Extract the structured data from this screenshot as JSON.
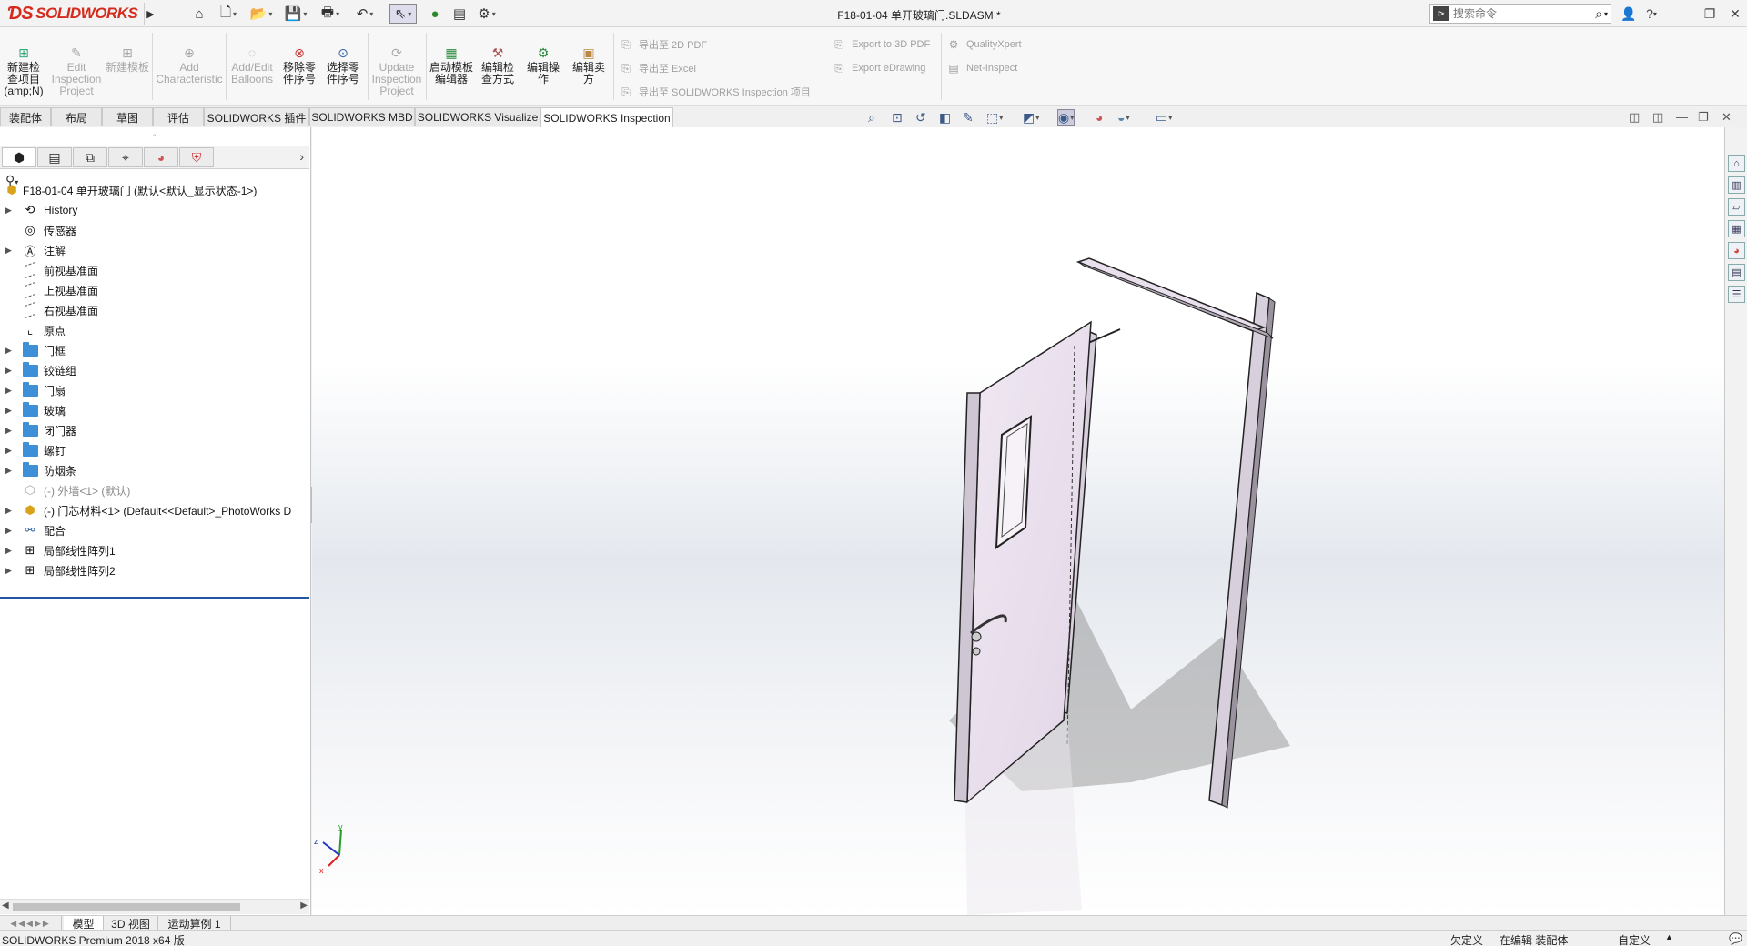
{
  "app": {
    "brand": "SOLIDWORKS",
    "document_title": "F18-01-04 单开玻璃门.SLDASM *",
    "search_placeholder": "搜索命令"
  },
  "command_manager": {
    "big_buttons": [
      {
        "label": "新建检查项目(amp;N)",
        "enabled": true,
        "icon": "new-project-icon"
      },
      {
        "label": "Edit Inspection Project",
        "enabled": false,
        "icon": "edit-project-icon"
      },
      {
        "label": "新建模板",
        "enabled": false,
        "icon": "new-template-icon"
      },
      {
        "label": "Add Characteristic",
        "enabled": false,
        "icon": "add-characteristic-icon"
      },
      {
        "label": "Add/Edit Balloons",
        "enabled": false,
        "icon": "balloon-icon"
      },
      {
        "label": "移除零件序号",
        "enabled": true,
        "icon": "remove-balloon-icon"
      },
      {
        "label": "选择零件序号",
        "enabled": true,
        "icon": "select-balloon-icon"
      },
      {
        "label": "Update Inspection Project",
        "enabled": false,
        "icon": "update-project-icon"
      },
      {
        "label": "启动模板编辑器",
        "enabled": true,
        "icon": "template-editor-icon"
      },
      {
        "label": "编辑检查方式",
        "enabled": true,
        "icon": "edit-method-icon"
      },
      {
        "label": "编辑操作",
        "enabled": true,
        "icon": "edit-operation-icon"
      },
      {
        "label": "编辑卖方",
        "enabled": true,
        "icon": "edit-vendor-icon"
      }
    ],
    "export_group_1": [
      "导出至 2D PDF",
      "导出至 Excel",
      "导出至 SOLIDWORKS Inspection 项目"
    ],
    "export_group_2": [
      "Export to 3D PDF",
      "Export eDrawing"
    ],
    "export_group_3": [
      "QualityXpert",
      "Net-Inspect"
    ]
  },
  "tabs": [
    "装配体",
    "布局",
    "草图",
    "评估",
    "SOLIDWORKS 插件",
    "SOLIDWORKS MBD",
    "SOLIDWORKS Visualize",
    "SOLIDWORKS Inspection"
  ],
  "active_tab": "SOLIDWORKS Inspection",
  "feature_tree": {
    "root": "F18-01-04 单开玻璃门 (默认<默认_显示状态-1>)",
    "items": [
      {
        "label": "History",
        "expandable": true,
        "icon": "history-icon"
      },
      {
        "label": "传感器",
        "expandable": false,
        "icon": "sensor-icon"
      },
      {
        "label": "注解",
        "expandable": true,
        "icon": "annotation-icon"
      },
      {
        "label": "前视基准面",
        "expandable": false,
        "icon": "plane-icon"
      },
      {
        "label": "上视基准面",
        "expandable": false,
        "icon": "plane-icon"
      },
      {
        "label": "右视基准面",
        "expandable": false,
        "icon": "plane-icon"
      },
      {
        "label": "原点",
        "expandable": false,
        "icon": "origin-icon"
      },
      {
        "label": "门框",
        "expandable": true,
        "icon": "folder-icon"
      },
      {
        "label": "铰链组",
        "expandable": true,
        "icon": "folder-icon"
      },
      {
        "label": "门扇",
        "expandable": true,
        "icon": "folder-icon"
      },
      {
        "label": "玻璃",
        "expandable": true,
        "icon": "folder-icon"
      },
      {
        "label": "闭门器",
        "expandable": true,
        "icon": "folder-icon"
      },
      {
        "label": "螺钉",
        "expandable": true,
        "icon": "folder-icon"
      },
      {
        "label": "防烟条",
        "expandable": true,
        "icon": "folder-icon"
      },
      {
        "label": "(-) 外墙<1> (默认)",
        "expandable": false,
        "icon": "suppressed-part-icon",
        "gray": true
      },
      {
        "label": "(-) 门芯材料<1> (Default<<Default>_PhotoWorks D",
        "expandable": true,
        "icon": "part-icon"
      },
      {
        "label": "配合",
        "expandable": true,
        "icon": "mates-icon"
      },
      {
        "label": "局部线性阵列1",
        "expandable": true,
        "icon": "pattern-icon"
      },
      {
        "label": "局部线性阵列2",
        "expandable": true,
        "icon": "pattern-icon"
      }
    ]
  },
  "bottom_tabs": [
    "模型",
    "3D 视图",
    "运动算例 1"
  ],
  "status": {
    "product": "SOLIDWORKS Premium 2018 x64 版",
    "definition": "欠定义",
    "editing": "在编辑 装配体",
    "units": "自定义"
  },
  "triad": {
    "x": "x",
    "y": "y",
    "z": "z"
  }
}
